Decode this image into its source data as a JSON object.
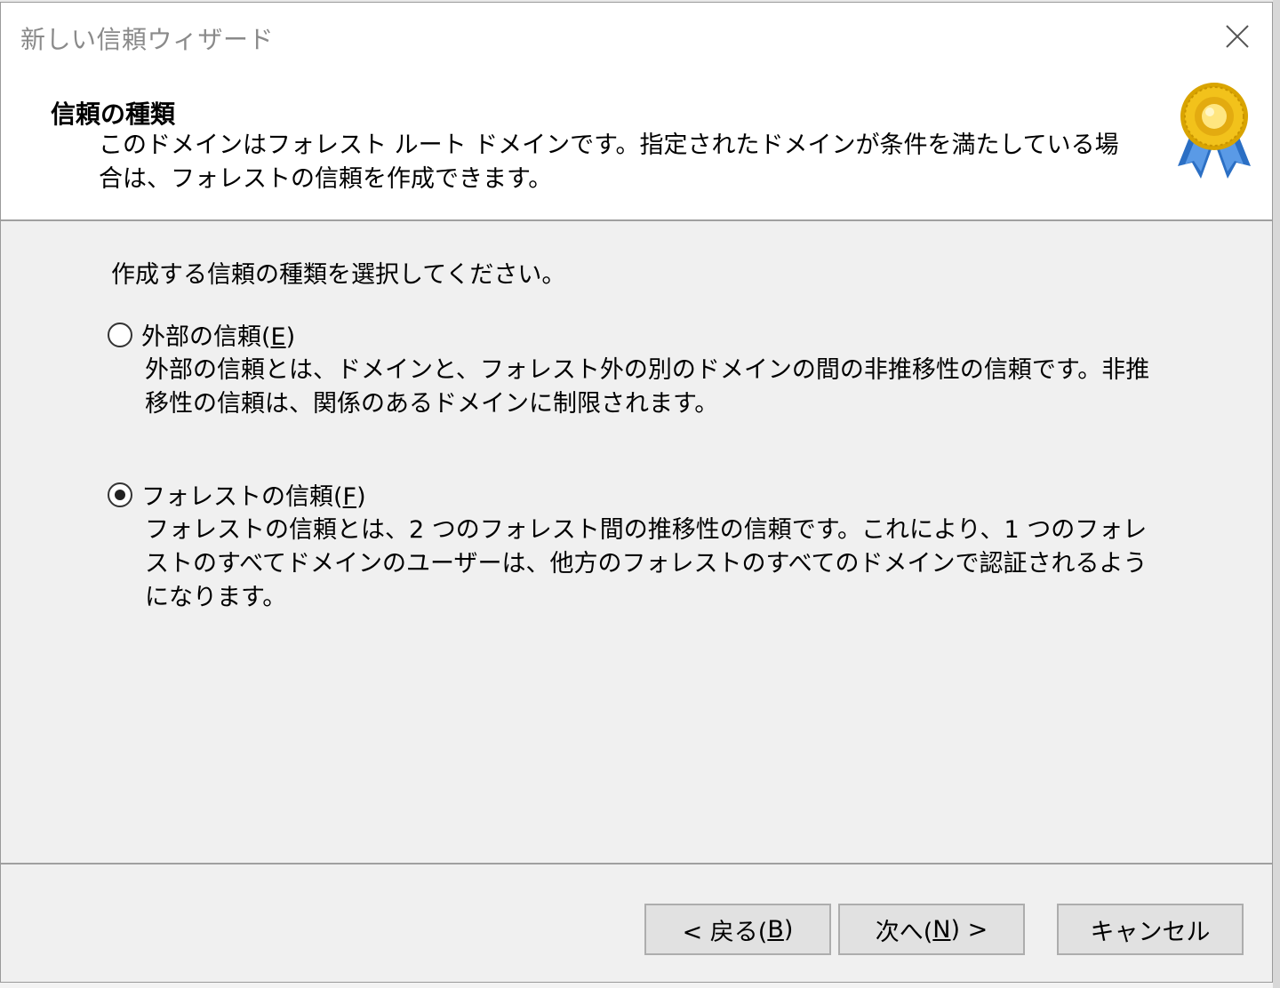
{
  "window": {
    "title": "新しい信頼ウィザード"
  },
  "header": {
    "title": "信頼の種類",
    "description": "このドメインはフォレスト ルート ドメインです。指定されたドメインが条件を満たしている場合は、フォレストの信頼を作成できます。"
  },
  "body": {
    "prompt": "作成する信頼の種類を選択してください。",
    "options": [
      {
        "label_pre": "外部の信頼(",
        "accel": "E",
        "label_post": ")",
        "description": "外部の信頼とは、ドメインと、フォレスト外の別のドメインの間の非推移性の信頼です。非推移性の信頼は、関係のあるドメインに制限されます。",
        "selected": false
      },
      {
        "label_pre": "フォレストの信頼(",
        "accel": "F",
        "label_post": ")",
        "description": "フォレストの信頼とは、2 つのフォレスト間の推移性の信頼です。これにより、1 つのフォレストのすべてドメインのユーザーは、他方のフォレストのすべてのドメインで認証されるようになります。",
        "selected": true
      }
    ]
  },
  "buttons": {
    "back": {
      "pre": "< 戻る(",
      "accel": "B",
      "post": ")"
    },
    "next": {
      "pre": "次へ(",
      "accel": "N",
      "post": ") >"
    },
    "cancel": "キャンセル"
  },
  "icons": {
    "close": "close-icon",
    "award": "award-ribbon-icon"
  }
}
